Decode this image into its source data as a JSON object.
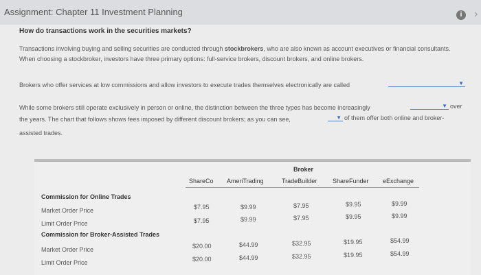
{
  "header": {
    "title": "Assignment: Chapter 11 Investment Planning"
  },
  "question": {
    "heading": "How do transactions work in the securities markets?",
    "para1_a": "Transactions involving buying and selling securities are conducted through ",
    "para1_b": "stockbrokers",
    "para1_c": ", who are also known as account executives or financial consultants. When choosing a stockbroker, investors have three primary options: full-service brokers, discount brokers, and online brokers.",
    "para2": "Brokers who offer services at low commissions and allow investors to execute trades themselves electronically are called",
    "para3_a": "While some brokers still operate exclusively in person or online, the distinction between the three types has become increasingly",
    "para3_over": "over",
    "para3_b": "the years. The chart that follows shows fees imposed by different discount brokers; as you can see,",
    "para3_c": "of them offer both online and broker-",
    "para3_d": "assisted trades."
  },
  "table": {
    "group_header": "Broker",
    "columns": [
      "ShareCo",
      "AmeriTrading",
      "TradeBuilder",
      "ShareFunder",
      "eExchange"
    ],
    "sections": [
      {
        "title": "Commission for Online Trades",
        "rows": [
          {
            "label": "Market Order Price",
            "values": [
              "$7.95",
              "$9.99",
              "$7.95",
              "$9.95",
              "$9.99"
            ]
          },
          {
            "label": "Limit Order Price",
            "values": [
              "$7.95",
              "$9.99",
              "$7.95",
              "$9.95",
              "$9.99"
            ]
          }
        ]
      },
      {
        "title": "Commission for Broker-Assisted Trades",
        "rows": [
          {
            "label": "Market Order Price",
            "values": [
              "$20.00",
              "$44.99",
              "$32.95",
              "$19.95",
              "$54.99"
            ]
          },
          {
            "label": "Limit Order Price",
            "values": [
              "$20.00",
              "$44.99",
              "$32.95",
              "$19.95",
              "$54.99"
            ]
          }
        ]
      }
    ]
  }
}
